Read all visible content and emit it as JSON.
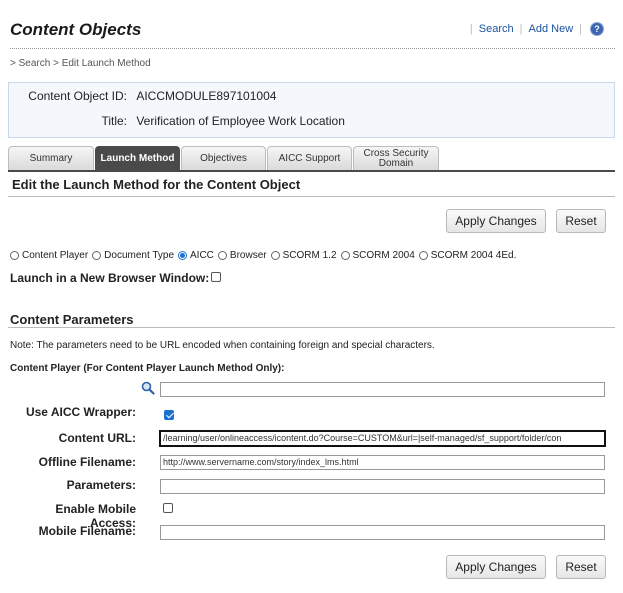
{
  "header": {
    "title": "Content Objects",
    "links": {
      "search": "Search",
      "add_new": "Add New",
      "separator": "|"
    },
    "help_glyph": "?"
  },
  "breadcrumb": "> Search > Edit Launch Method",
  "info": {
    "id_label": "Content Object ID:",
    "id_value": "AICCMODULE897101004",
    "title_label": "Title:",
    "title_value": "Verification of Employee Work Location"
  },
  "tabs": [
    "Summary",
    "Launch Method",
    "Objectives",
    "AICC Support",
    "Cross Security Domain"
  ],
  "active_tab": "Launch Method",
  "section_heading": "Edit the Launch Method for the Content Object",
  "buttons": {
    "apply": "Apply Changes",
    "reset": "Reset"
  },
  "launch_methods": {
    "options": [
      "Content Player",
      "Document Type",
      "AICC",
      "Browser",
      "SCORM 1.2",
      "SCORM 2004",
      "SCORM 2004 4Ed."
    ],
    "selected": "AICC"
  },
  "new_window": {
    "label": "Launch in a New Browser Window:",
    "checked": false
  },
  "params": {
    "heading": "Content Parameters",
    "note": "Note: The parameters need to be URL encoded when containing foreign and special characters.",
    "content_player_label": "Content Player (For Content Player Launch Method Only):",
    "content_player_value": "",
    "use_aicc_wrapper_label": "Use AICC Wrapper:",
    "use_aicc_wrapper_checked": true,
    "content_url_label": "Content URL:",
    "content_url_value": "/learning/user/onlineaccess/icontent.do?Course=CUSTOM&url=|self-managed/sf_support/folder/con",
    "offline_filename_label": "Offline Filename:",
    "offline_filename_value": "http://www.servername.com/story/index_lms.html",
    "parameters_label": "Parameters:",
    "parameters_value": "",
    "mobile_access_label": "Enable Mobile Access:",
    "mobile_access_checked": false,
    "mobile_filename_label": "Mobile Filename:",
    "mobile_filename_value": ""
  },
  "icons": {
    "search": "magnifier-icon",
    "help": "help-icon"
  },
  "colors": {
    "link": "#1a52a2",
    "active_tab": "#4a4a4a",
    "info_bg": "#f4f8fc",
    "radio_selected": "#1a6fd1"
  }
}
